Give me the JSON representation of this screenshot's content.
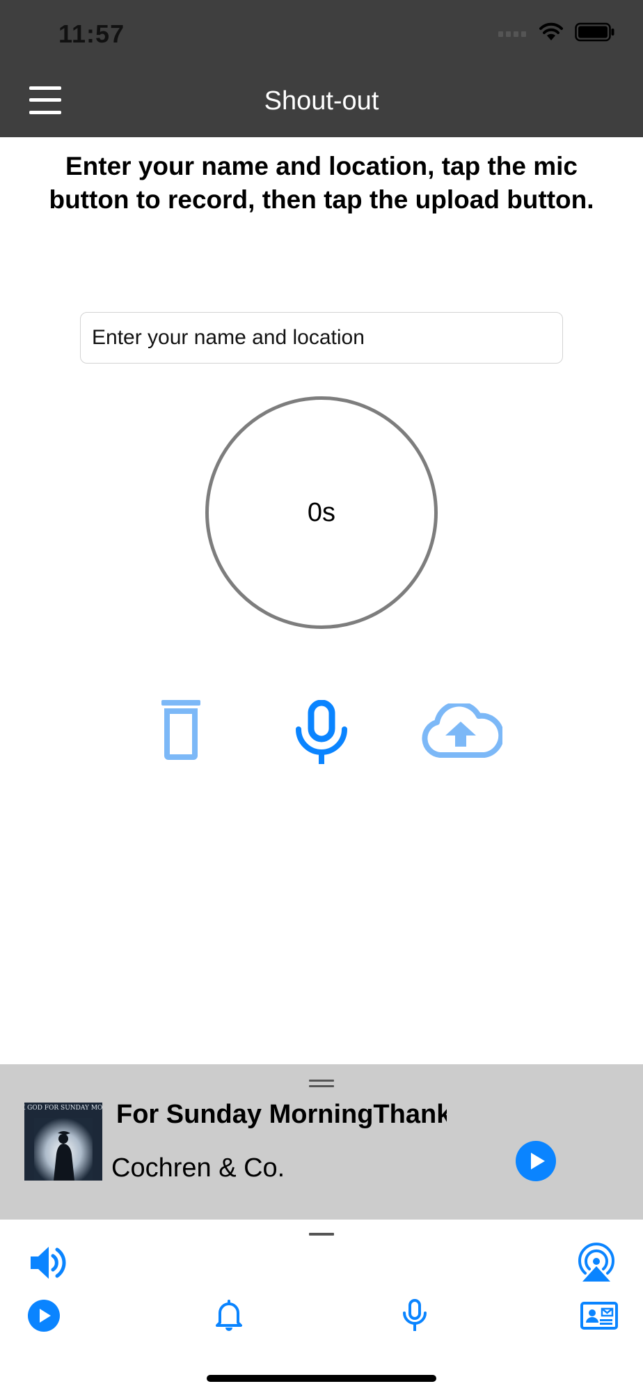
{
  "status_bar": {
    "time": "11:57",
    "icons": [
      "cellular-signal-icon",
      "wifi-icon",
      "battery-icon"
    ]
  },
  "nav": {
    "title": "Shout-out",
    "menu_icon": "hamburger-menu-icon"
  },
  "instructions": "Enter your name and location, tap the mic button to record, then tap the upload button.",
  "name_input": {
    "placeholder": "Enter your name and location",
    "value": ""
  },
  "timer": {
    "label": "0s"
  },
  "actions": [
    {
      "name": "delete",
      "icon": "trash-icon"
    },
    {
      "name": "record",
      "icon": "microphone-icon"
    },
    {
      "name": "upload",
      "icon": "cloud-upload-icon"
    }
  ],
  "now_playing": {
    "title": "Thank God For Sunday MorningThank God For Sunday Morning",
    "artist": "Cochren & Co.",
    "album_art_text": "THANK GOD FOR SUNDAY MORNING",
    "play_icon": "play-circle-icon"
  },
  "bottom_toolbar": {
    "top_row": [
      "volume-icon",
      "airplay-icon"
    ],
    "bottom_row": [
      "play-circle-icon",
      "bell-icon",
      "microphone-icon",
      "contact-card-icon"
    ]
  },
  "colors": {
    "bar_background": "#3f3f3f",
    "accent_blue": "#0a84ff",
    "light_blue": "#7cb8f7",
    "player_background": "#cccccc"
  }
}
